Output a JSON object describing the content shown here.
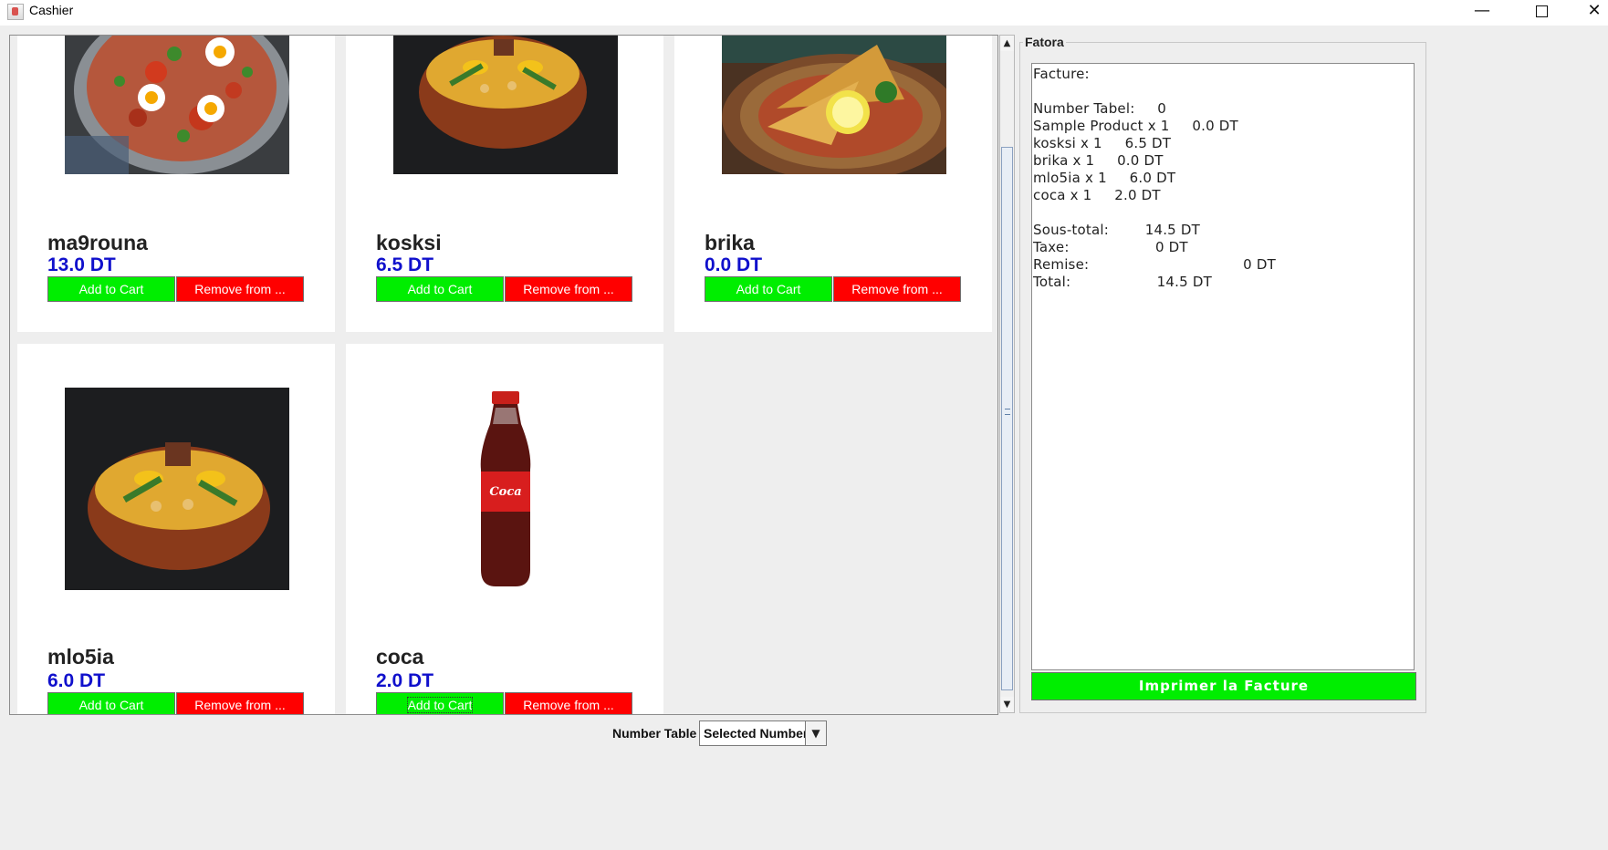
{
  "window": {
    "title": "Cashier",
    "minimize": "—",
    "close": "✕"
  },
  "products": [
    {
      "name": "ma9rouna",
      "price": "13.0 DT",
      "add_label": "Add to Cart",
      "remove_label": "Remove from ...",
      "image_icon": "shakshuka-dish-photo"
    },
    {
      "name": "kosksi",
      "price": "6.5 DT",
      "add_label": "Add to Cart",
      "remove_label": "Remove from ...",
      "image_icon": "couscous-dish-photo"
    },
    {
      "name": "brika",
      "price": "0.0 DT",
      "add_label": "Add to Cart",
      "remove_label": "Remove from ...",
      "image_icon": "brik-pastry-photo"
    },
    {
      "name": "mlo5ia",
      "price": "6.0 DT",
      "add_label": "Add to Cart",
      "remove_label": "Remove from ...",
      "image_icon": "couscous-dish-photo"
    },
    {
      "name": "coca",
      "price": "2.0 DT",
      "add_label": "Add to Cart",
      "remove_label": "Remove from ...",
      "image_icon": "coca-cola-bottle-photo"
    }
  ],
  "fatora": {
    "title": "Fatora",
    "lines": [
      "Facture:",
      "",
      "Number Tabel:     0",
      "Sample Product x 1     0.0 DT",
      "kosksi x 1     6.5 DT",
      "brika x 1     0.0 DT",
      "mlo5ia x 1     6.0 DT",
      "coca x 1     2.0 DT",
      "",
      "Sous-total:        14.5 DT",
      "Taxe:                   0 DT",
      "Remise:                                  0 DT",
      "Total:                   14.5 DT"
    ],
    "print_label": "Imprimer la Facture"
  },
  "footer": {
    "label": "Number Table",
    "select_value": "Selected Number"
  },
  "colors": {
    "add": "#00ee00",
    "remove": "#ff0000",
    "price": "#1010cc",
    "print": "#00ee00"
  }
}
